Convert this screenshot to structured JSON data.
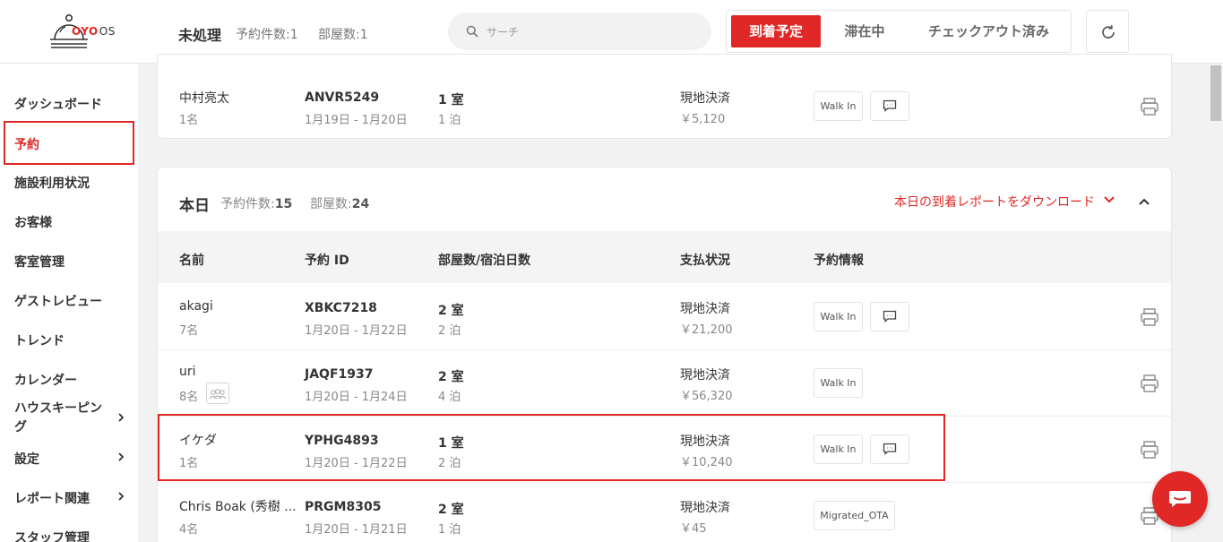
{
  "header": {
    "logo_brand": "OYO",
    "logo_os": "OS",
    "title": "未処理",
    "count_bookings": "予約件数:1",
    "count_rooms": "部屋数:1",
    "search_placeholder": "サーチ",
    "tabs": [
      "到着予定",
      "滞在中",
      "チェックアウト済み"
    ],
    "accent_color": "#e02826"
  },
  "sidebar": {
    "items": [
      {
        "label": "ダッシュボード",
        "icon": ""
      },
      {
        "label": "予約",
        "selected": true
      },
      {
        "label": "施設利用状況"
      },
      {
        "label": "お客様"
      },
      {
        "label": "客室管理"
      },
      {
        "label": "ゲストレビュー"
      },
      {
        "label": "トレンド"
      },
      {
        "label": "カレンダー"
      },
      {
        "label": "ハウスキーピング",
        "has_submenu": true
      },
      {
        "label": "設定",
        "has_submenu": true
      },
      {
        "label": "レポート関連",
        "has_submenu": true
      },
      {
        "label": "スタッフ管理"
      }
    ]
  },
  "pending": {
    "row": {
      "name": "中村亮太",
      "guests": "1名",
      "booking_id": "ANVR5249",
      "dates": "1月19日 - 1月20日",
      "rooms": "1 室",
      "nights": "1 泊",
      "payment": "現地決済",
      "amount": "￥5,120",
      "tag": "Walk In"
    }
  },
  "today": {
    "title": "本日",
    "count_bookings_label": "予約件数:",
    "count_bookings_value": "15",
    "count_rooms_label": "部屋数:",
    "count_rooms_value": "24",
    "download_link": "本日の到着レポートをダウンロード",
    "columns": [
      "名前",
      "予約 ID",
      "部屋数/宿泊日数",
      "支払状況",
      "予約情報"
    ],
    "rows": [
      {
        "name": "akagi",
        "guests": "7名",
        "booking_id": "XBKC7218",
        "dates": "1月20日 - 1月22日",
        "rooms": "2 室",
        "nights": "2 泊",
        "payment": "現地決済",
        "amount": "￥21,200",
        "tag": "Walk In",
        "has_message": true
      },
      {
        "name": "uri",
        "guests": "8名",
        "booking_id": "JAQF1937",
        "dates": "1月20日 - 1月24日",
        "rooms": "2 室",
        "nights": "4 泊",
        "payment": "現地決済",
        "amount": "￥56,320",
        "tag": "Walk In",
        "has_message": false,
        "group_icon": true
      },
      {
        "name": "イケダ",
        "guests": "1名",
        "booking_id": "YPHG4893",
        "dates": "1月20日 - 1月22日",
        "rooms": "1 室",
        "nights": "2 泊",
        "payment": "現地決済",
        "amount": "￥10,240",
        "tag": "Walk In",
        "has_message": true,
        "highlighted": true
      },
      {
        "name": "Chris Boak (秀樹 ...",
        "guests": "4名",
        "booking_id": "PRGM8305",
        "dates": "1月20日 - 1月21日",
        "rooms": "2 室",
        "nights": "1 泊",
        "payment": "現地決済",
        "amount": "￥45",
        "tag": "Migrated_OTA",
        "has_message": false
      }
    ]
  }
}
